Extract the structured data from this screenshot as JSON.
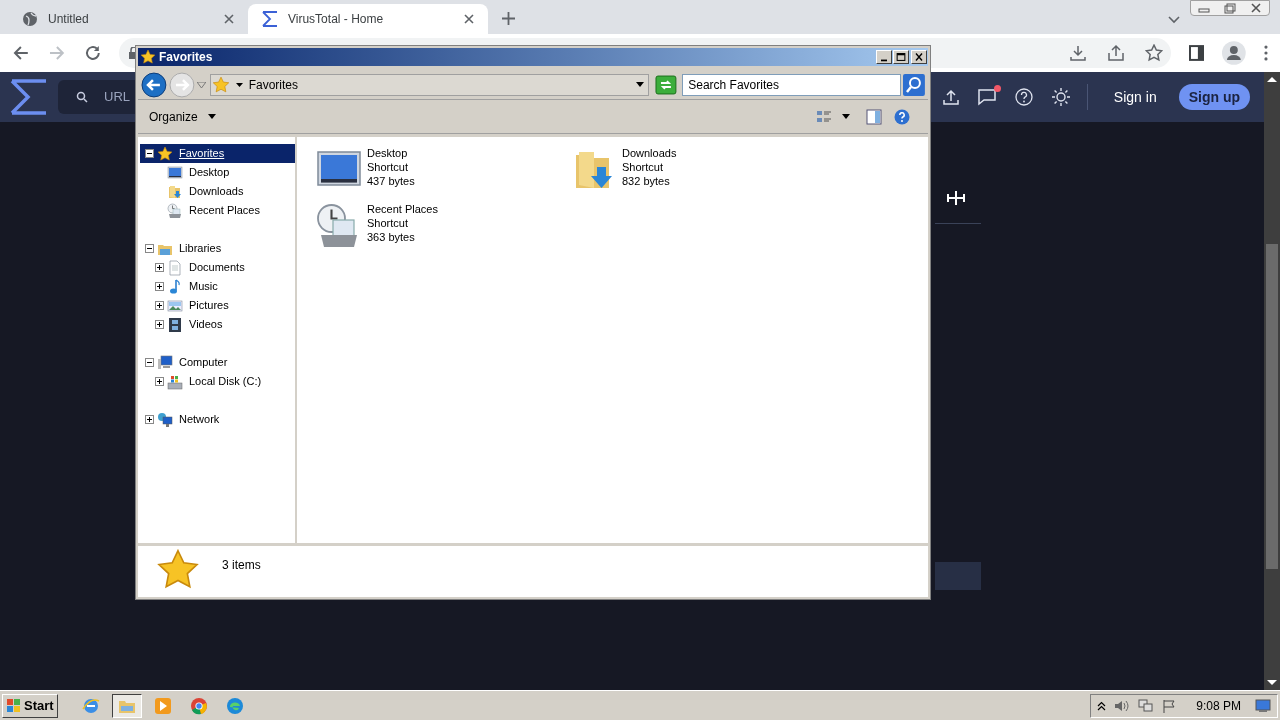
{
  "browser": {
    "tabs": [
      {
        "label": "Untitled",
        "selected": false,
        "kind": "globe"
      },
      {
        "label": "VirusTotal - Home",
        "selected": true,
        "kind": "sigma"
      }
    ]
  },
  "site_header": {
    "search": {
      "placeholder": "URL"
    },
    "notification_dot": true,
    "sign_in": "Sign in",
    "sign_up": "Sign up"
  },
  "explorer": {
    "title": "Favorites",
    "address": "Favorites",
    "search": {
      "placeholder": "Search Favorites"
    },
    "organize": "Organize",
    "tree": [
      {
        "label": "Favorites",
        "kind": "star",
        "expanded": true,
        "selected": true,
        "children": [
          {
            "label": "Desktop",
            "kind": "monitor",
            "selected": false
          },
          {
            "label": "Downloads",
            "kind": "downloads",
            "selected": false
          },
          {
            "label": "Recent Places",
            "kind": "recent",
            "selected": false
          }
        ]
      },
      {
        "label": "Libraries",
        "kind": "library",
        "expanded": true,
        "selected": false,
        "children": [
          {
            "label": "Documents",
            "kind": "document",
            "expanded": false,
            "selected": false
          },
          {
            "label": "Music",
            "kind": "music",
            "expanded": false,
            "selected": false
          },
          {
            "label": "Pictures",
            "kind": "pictures",
            "expanded": false,
            "selected": false
          },
          {
            "label": "Videos",
            "kind": "videos",
            "expanded": false,
            "selected": false
          }
        ]
      },
      {
        "label": "Computer",
        "kind": "computer",
        "expanded": true,
        "selected": false,
        "children": [
          {
            "label": "Local Disk (C:)",
            "kind": "disk",
            "expanded": false,
            "selected": false
          }
        ]
      },
      {
        "label": "Network",
        "kind": "network",
        "expanded": false,
        "selected": false
      }
    ],
    "files": [
      {
        "name": "Desktop",
        "type": "Shortcut",
        "size": "437 bytes",
        "kind": "monitor"
      },
      {
        "name": "Downloads",
        "type": "Shortcut",
        "size": "832 bytes",
        "kind": "downloads"
      },
      {
        "name": "Recent Places",
        "type": "Shortcut",
        "size": "363 bytes",
        "kind": "recent"
      }
    ],
    "status": "3 items"
  },
  "taskbar": {
    "start": "Start",
    "apps": [
      {
        "kind": "ie",
        "selected": false
      },
      {
        "kind": "explorer",
        "selected": true
      },
      {
        "kind": "media",
        "selected": false
      },
      {
        "kind": "chrome",
        "selected": false
      },
      {
        "kind": "edge",
        "selected": false
      }
    ],
    "clock": "9:08 PM"
  }
}
